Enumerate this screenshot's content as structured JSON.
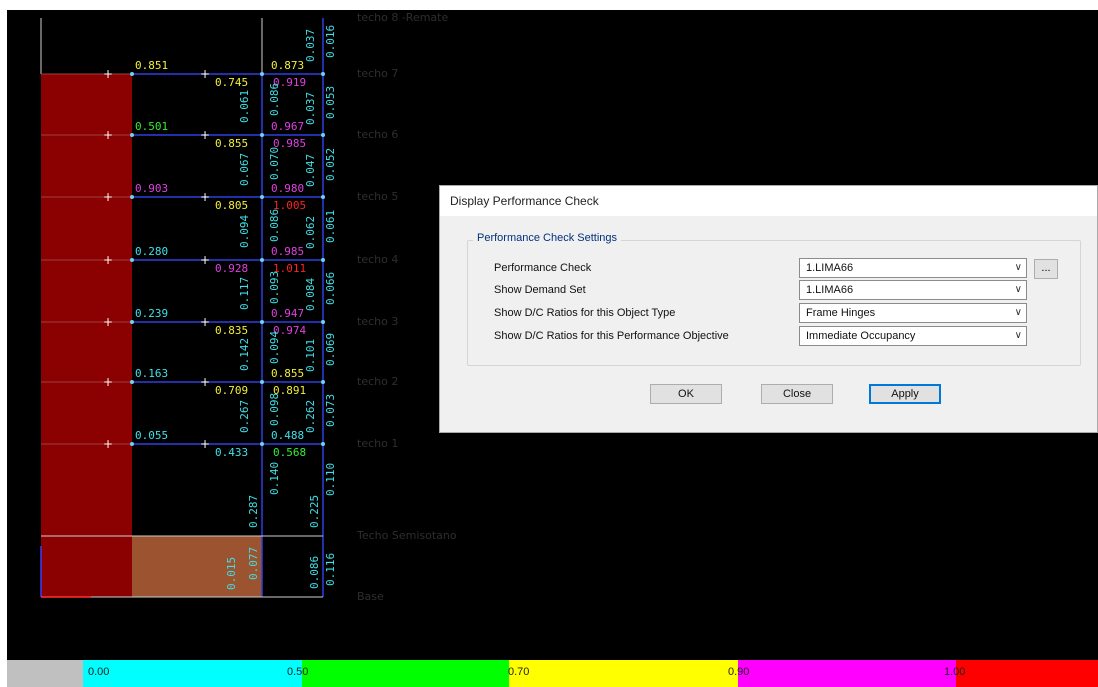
{
  "model_view": {
    "story_labels": [
      {
        "id": "r",
        "text": "techo 8 -Remate"
      },
      {
        "id": "7",
        "text": "techo 7"
      },
      {
        "id": "6",
        "text": "techo 6"
      },
      {
        "id": "5",
        "text": "techo 5"
      },
      {
        "id": "4",
        "text": "techo 4"
      },
      {
        "id": "3",
        "text": "techo 3"
      },
      {
        "id": "2",
        "text": "techo 2"
      },
      {
        "id": "1",
        "text": "techo 1"
      },
      {
        "id": "s",
        "text": "Techo Semisotano"
      },
      {
        "id": "b",
        "text": "Base"
      }
    ],
    "story_ratios": [
      {
        "beam_left": "0.851",
        "beam_mid": "0.745",
        "beam_right_top": "0.873",
        "beam_right_bottom": "0.919"
      },
      {
        "beam_left": "0.501",
        "beam_mid": "0.855",
        "beam_right_top": "0.967",
        "beam_right_bottom": "0.985"
      },
      {
        "beam_left": "0.903",
        "beam_mid": "0.805",
        "beam_right_top": "0.980",
        "beam_right_bottom": "1.005"
      },
      {
        "beam_left": "0.280",
        "beam_mid": "0.928",
        "beam_right_top": "0.985",
        "beam_right_bottom": "1.011"
      },
      {
        "beam_left": "0.239",
        "beam_mid": "0.835",
        "beam_right_top": "0.947",
        "beam_right_bottom": "0.974"
      },
      {
        "beam_left": "0.163",
        "beam_mid": "0.709",
        "beam_right_top": "0.855",
        "beam_right_bottom": "0.891"
      },
      {
        "beam_left": "0.055",
        "beam_mid": "0.433",
        "beam_right_top": "0.488",
        "beam_right_bottom": "0.568"
      }
    ],
    "column_ratios": [
      {
        "text": "0.037"
      },
      {
        "text": "0.016"
      },
      {
        "text": "0.061"
      },
      {
        "text": "0.086"
      },
      {
        "text": "0.037"
      },
      {
        "text": "0.053"
      },
      {
        "text": "0.067"
      },
      {
        "text": "0.070"
      },
      {
        "text": "0.047"
      },
      {
        "text": "0.052"
      },
      {
        "text": "0.094"
      },
      {
        "text": "0.086"
      },
      {
        "text": "0.062"
      },
      {
        "text": "0.061"
      },
      {
        "text": "0.117"
      },
      {
        "text": "0.093"
      },
      {
        "text": "0.084"
      },
      {
        "text": "0.066"
      },
      {
        "text": "0.142"
      },
      {
        "text": "0.094"
      },
      {
        "text": "0.101"
      },
      {
        "text": "0.069"
      },
      {
        "text": "0.267"
      },
      {
        "text": "0.098"
      },
      {
        "text": "0.262"
      },
      {
        "text": "0.073"
      },
      {
        "text": "0.140"
      },
      {
        "text": "0.110"
      },
      {
        "text": "0.287"
      },
      {
        "text": "0.225"
      },
      {
        "text": "0.015"
      },
      {
        "text": "0.077"
      },
      {
        "text": "0.086"
      },
      {
        "text": "0.116"
      }
    ],
    "colors": {
      "wall": "#8b0000",
      "basement_slab": "#9b5330",
      "beam_line": "#2f3fe0",
      "ratio_cyan": "#3fe0e8",
      "ratio_green": "#33ee33",
      "ratio_yellow": "#f2ee3a",
      "ratio_magenta": "#e040e0",
      "ratio_red": "#ff2222",
      "story_label": "#2e2e2e"
    }
  },
  "legend": {
    "ticks": [
      "0.00",
      "0.50",
      "0.70",
      "0.90",
      "1.00"
    ],
    "segments": [
      {
        "color": "#c0c0c0",
        "from": 0.0,
        "to": 0.07
      },
      {
        "color": "#00ffff",
        "from": 0.07,
        "to": 0.27
      },
      {
        "color": "#00ff00",
        "from": 0.27,
        "to": 0.46
      },
      {
        "color": "#ffff00",
        "from": 0.46,
        "to": 0.67
      },
      {
        "color": "#ff00ff",
        "from": 0.67,
        "to": 0.87
      },
      {
        "color": "#ff0000",
        "from": 0.87,
        "to": 1.0
      }
    ]
  },
  "dialog": {
    "title": "Display Performance Check",
    "group_title": "Performance Check Settings",
    "rows": [
      {
        "label": "Performance Check",
        "value": "1.LIMA66"
      },
      {
        "label": "Show Demand Set",
        "value": "1.LIMA66"
      },
      {
        "label": "Show D/C Ratios for this Object Type",
        "value": "Frame Hinges"
      },
      {
        "label": "Show D/C Ratios for this Performance Objective",
        "value": "Immediate Occupancy"
      }
    ],
    "ellipsis_label": "...",
    "buttons": {
      "ok": "OK",
      "close": "Close",
      "apply": "Apply"
    }
  }
}
